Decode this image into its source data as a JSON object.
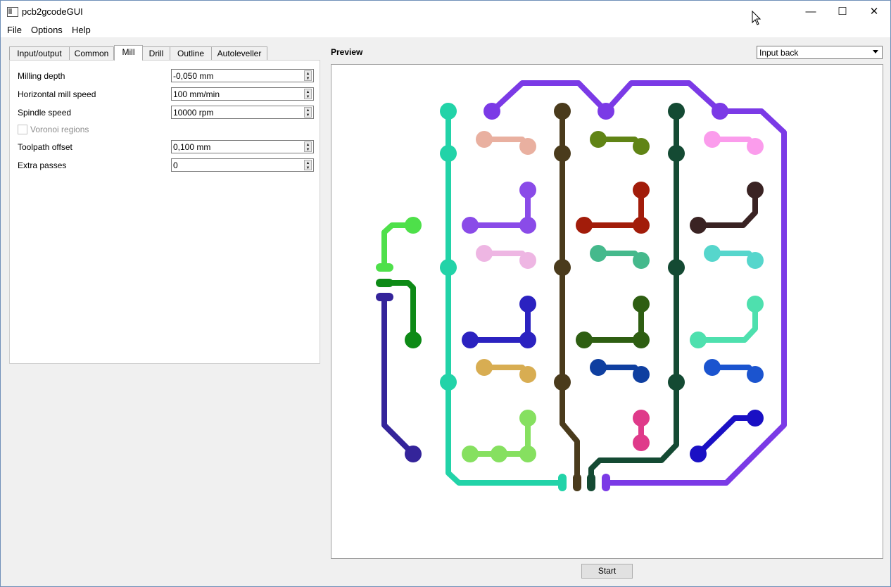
{
  "window": {
    "title": "pcb2gcodeGUI",
    "controls": {
      "minimize": "—",
      "maximize": "☐",
      "close": "✕"
    }
  },
  "menu": [
    "File",
    "Options",
    "Help"
  ],
  "tabs": [
    "Input/output",
    "Common",
    "Mill",
    "Drill",
    "Outline",
    "Autoleveller"
  ],
  "active_tab": "Mill",
  "mill": {
    "milling_depth": {
      "label": "Milling depth",
      "value": "-0,050 mm"
    },
    "horizontal_mill_speed": {
      "label": "Horizontal mill speed",
      "value": "100 mm/min"
    },
    "spindle_speed": {
      "label": "Spindle speed",
      "value": "10000 rpm"
    },
    "voronoi_regions": {
      "label": "Voronoi regions",
      "checked": false,
      "enabled": false
    },
    "toolpath_offset": {
      "label": "Toolpath offset",
      "value": "0,100 mm"
    },
    "extra_passes": {
      "label": "Extra passes",
      "value": "0"
    }
  },
  "preview": {
    "label": "Preview",
    "view_select": {
      "value": "Input back"
    }
  },
  "start_button": "Start"
}
